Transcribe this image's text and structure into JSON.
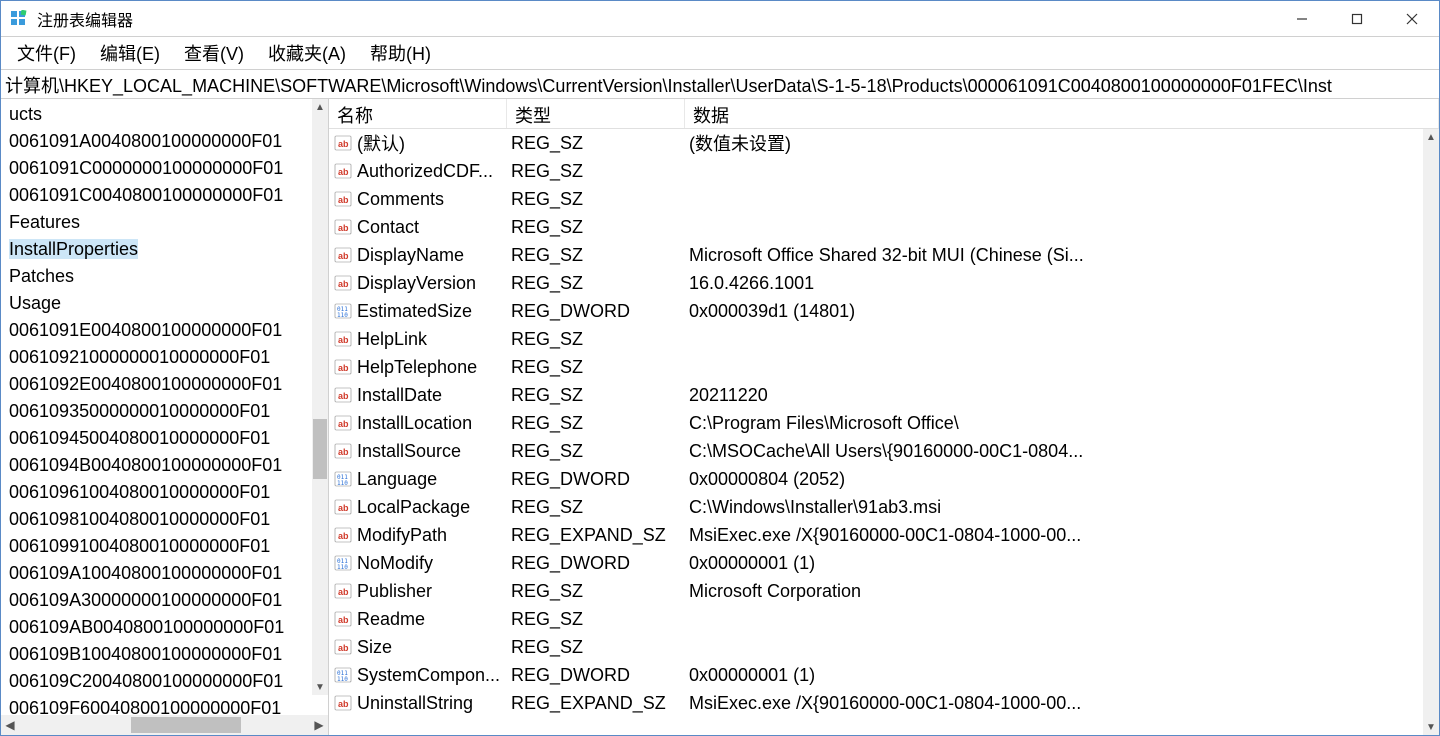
{
  "window": {
    "title": "注册表编辑器"
  },
  "menu": {
    "file": "文件(F)",
    "edit": "编辑(E)",
    "view": "查看(V)",
    "favorites": "收藏夹(A)",
    "help": "帮助(H)"
  },
  "address": "计算机\\HKEY_LOCAL_MACHINE\\SOFTWARE\\Microsoft\\Windows\\CurrentVersion\\Installer\\UserData\\S-1-5-18\\Products\\000061091C0040800100000000F01FEC\\Inst",
  "tree": {
    "items": [
      "ucts",
      "0061091A0040800100000000F01",
      "0061091C0000000100000000F01",
      "0061091C0040800100000000F01",
      "Features",
      "InstallProperties",
      "Patches",
      "Usage",
      "0061091E0040800100000000F01",
      "00610921000000010000000F01",
      "0061092E0040800100000000F01",
      "00610935000000010000000F01",
      "00610945004080010000000F01",
      "0061094B0040800100000000F01",
      "00610961004080010000000F01",
      "00610981004080010000000F01",
      "00610991004080010000000F01",
      "006109A10040800100000000F01",
      "006109A30000000100000000F01",
      "006109AB0040800100000000F01",
      "006109B10040800100000000F01",
      "006109C20040800100000000F01",
      "006109F60040800100000000F01"
    ],
    "selected_index": 5
  },
  "list": {
    "columns": {
      "name": "名称",
      "type": "类型",
      "data": "数据"
    },
    "rows": [
      {
        "icon": "string",
        "name": "(默认)",
        "type": "REG_SZ",
        "data": "(数值未设置)"
      },
      {
        "icon": "string",
        "name": "AuthorizedCDF...",
        "type": "REG_SZ",
        "data": ""
      },
      {
        "icon": "string",
        "name": "Comments",
        "type": "REG_SZ",
        "data": ""
      },
      {
        "icon": "string",
        "name": "Contact",
        "type": "REG_SZ",
        "data": ""
      },
      {
        "icon": "string",
        "name": "DisplayName",
        "type": "REG_SZ",
        "data": "Microsoft Office Shared 32-bit MUI (Chinese (Si..."
      },
      {
        "icon": "string",
        "name": "DisplayVersion",
        "type": "REG_SZ",
        "data": "16.0.4266.1001"
      },
      {
        "icon": "binary",
        "name": "EstimatedSize",
        "type": "REG_DWORD",
        "data": "0x000039d1 (14801)"
      },
      {
        "icon": "string",
        "name": "HelpLink",
        "type": "REG_SZ",
        "data": ""
      },
      {
        "icon": "string",
        "name": "HelpTelephone",
        "type": "REG_SZ",
        "data": ""
      },
      {
        "icon": "string",
        "name": "InstallDate",
        "type": "REG_SZ",
        "data": "20211220"
      },
      {
        "icon": "string",
        "name": "InstallLocation",
        "type": "REG_SZ",
        "data": "C:\\Program Files\\Microsoft Office\\"
      },
      {
        "icon": "string",
        "name": "InstallSource",
        "type": "REG_SZ",
        "data": "C:\\MSOCache\\All Users\\{90160000-00C1-0804..."
      },
      {
        "icon": "binary",
        "name": "Language",
        "type": "REG_DWORD",
        "data": "0x00000804 (2052)"
      },
      {
        "icon": "string",
        "name": "LocalPackage",
        "type": "REG_SZ",
        "data": "C:\\Windows\\Installer\\91ab3.msi"
      },
      {
        "icon": "string",
        "name": "ModifyPath",
        "type": "REG_EXPAND_SZ",
        "data": "MsiExec.exe /X{90160000-00C1-0804-1000-00..."
      },
      {
        "icon": "binary",
        "name": "NoModify",
        "type": "REG_DWORD",
        "data": "0x00000001 (1)"
      },
      {
        "icon": "string",
        "name": "Publisher",
        "type": "REG_SZ",
        "data": "Microsoft Corporation"
      },
      {
        "icon": "string",
        "name": "Readme",
        "type": "REG_SZ",
        "data": ""
      },
      {
        "icon": "string",
        "name": "Size",
        "type": "REG_SZ",
        "data": ""
      },
      {
        "icon": "binary",
        "name": "SystemCompon...",
        "type": "REG_DWORD",
        "data": "0x00000001 (1)"
      },
      {
        "icon": "string",
        "name": "UninstallString",
        "type": "REG_EXPAND_SZ",
        "data": "MsiExec.exe /X{90160000-00C1-0804-1000-00..."
      }
    ]
  }
}
